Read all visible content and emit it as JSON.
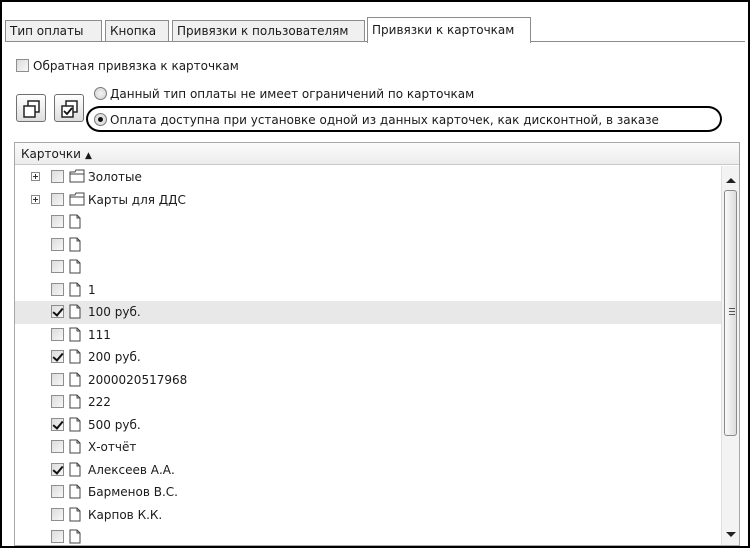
{
  "tabs": [
    {
      "label": "Тип оплаты",
      "active": false
    },
    {
      "label": "Кнопка",
      "active": false
    },
    {
      "label": "Привязки к пользователям",
      "active": false
    },
    {
      "label": "Привязки к карточкам",
      "active": true
    }
  ],
  "reverse_binding": {
    "label": "Обратная привязка к карточкам",
    "checked": false
  },
  "toolbar": {
    "button1_icon": "copy-icon",
    "button2_icon": "edit-select-icon"
  },
  "radios": [
    {
      "label": "Данный тип оплаты не имеет ограничений по карточкам",
      "selected": false
    },
    {
      "label": "Оплата доступна при установке одной из данных карточек, как дисконтной, в заказе",
      "selected": true
    }
  ],
  "grid": {
    "header": "Карточки",
    "sort_icon": "sort-ascending-icon",
    "rows": [
      {
        "type": "folder",
        "expandable": true,
        "checked": false,
        "label": "Золотые"
      },
      {
        "type": "folder",
        "expandable": true,
        "checked": false,
        "label": "Карты для ДДС"
      },
      {
        "type": "card",
        "expandable": false,
        "checked": false,
        "label": ""
      },
      {
        "type": "card",
        "expandable": false,
        "checked": false,
        "label": ""
      },
      {
        "type": "card",
        "expandable": false,
        "checked": false,
        "label": ""
      },
      {
        "type": "card",
        "expandable": false,
        "checked": false,
        "label": "1"
      },
      {
        "type": "card",
        "expandable": false,
        "checked": true,
        "label": "100 руб.",
        "highlighted": true
      },
      {
        "type": "card",
        "expandable": false,
        "checked": false,
        "label": "111"
      },
      {
        "type": "card",
        "expandable": false,
        "checked": true,
        "label": "200 руб."
      },
      {
        "type": "card",
        "expandable": false,
        "checked": false,
        "label": "2000020517968"
      },
      {
        "type": "card",
        "expandable": false,
        "checked": false,
        "label": "222"
      },
      {
        "type": "card",
        "expandable": false,
        "checked": true,
        "label": "500 руб."
      },
      {
        "type": "card",
        "expandable": false,
        "checked": false,
        "label": "Х-отчёт"
      },
      {
        "type": "card",
        "expandable": false,
        "checked": true,
        "label": "Алексеев А.А."
      },
      {
        "type": "card",
        "expandable": false,
        "checked": false,
        "label": "Барменов В.С."
      },
      {
        "type": "card",
        "expandable": false,
        "checked": false,
        "label": "Карпов К.К."
      },
      {
        "type": "card",
        "expandable": false,
        "checked": false,
        "label": ""
      }
    ]
  },
  "colors": {
    "highlight_row": "#e8e8e8",
    "ellipse": "#000000"
  }
}
